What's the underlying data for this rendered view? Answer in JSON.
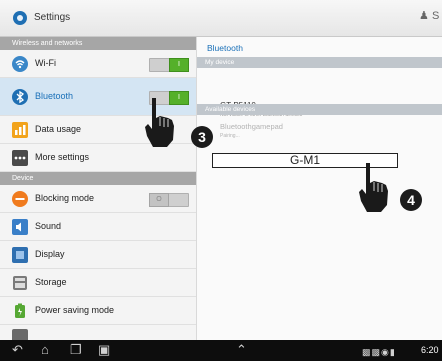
{
  "topbar": {
    "title": "Settings",
    "right_fragment": "S"
  },
  "sidebar": {
    "sections": [
      {
        "label": "Wireless and networks"
      },
      {
        "label": "Device"
      }
    ],
    "items": [
      {
        "label": "Wi-Fi",
        "toggle": "I",
        "icon": "wifi-icon"
      },
      {
        "label": "Bluetooth",
        "toggle": "I",
        "icon": "bluetooth-icon"
      },
      {
        "label": "Data usage",
        "icon": "data-usage-icon"
      },
      {
        "label": "More settings",
        "icon": "more-settings-icon"
      },
      {
        "label": "Blocking mode",
        "toggle": "O",
        "icon": "blocking-mode-icon"
      },
      {
        "label": "Sound",
        "icon": "sound-icon"
      },
      {
        "label": "Display",
        "icon": "display-icon"
      },
      {
        "label": "Storage",
        "icon": "storage-icon"
      },
      {
        "label": "Power saving mode",
        "icon": "power-saving-icon"
      }
    ]
  },
  "panel": {
    "title": "Bluetooth",
    "my_device_header": "My device",
    "my_device": {
      "name": "GT-P5110",
      "status": "Not visible to other Bluetooth devices"
    },
    "available_header": "Available devices",
    "available": [
      {
        "name": "Bluetoothgamepad",
        "status": "Pairing..."
      }
    ],
    "highlight_label": "G-M1"
  },
  "overlay": {
    "step_three": "3",
    "step_four": "4"
  },
  "navbar": {
    "clock": "6:20"
  },
  "colors": {
    "accent": "#1a70b8",
    "toggle_on": "#55b02a"
  }
}
